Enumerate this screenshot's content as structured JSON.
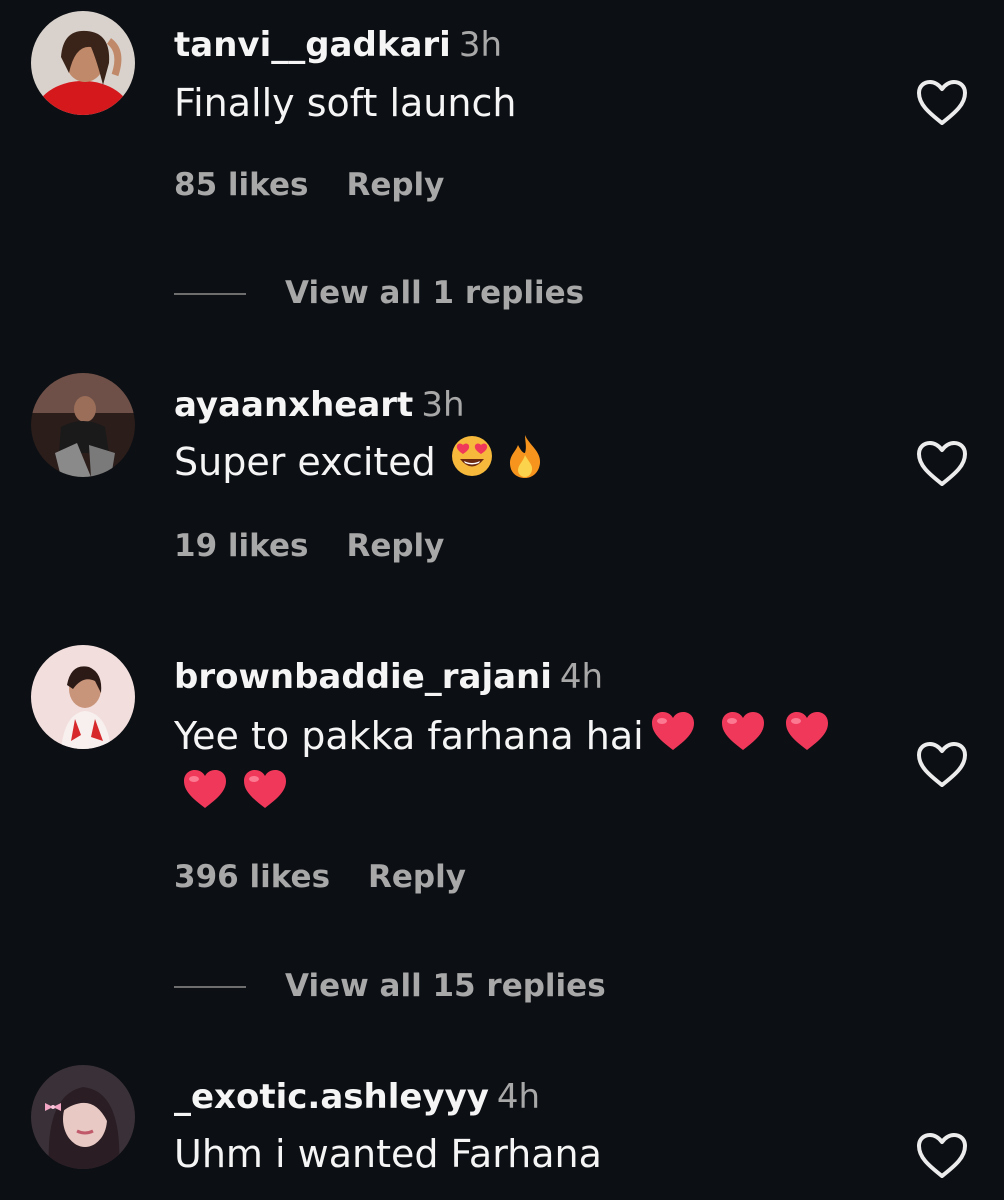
{
  "comments": [
    {
      "username": "tanvi__gadkari",
      "time": "3h",
      "text": "Finally soft launch",
      "likes": "85 likes",
      "reply_label": "Reply",
      "view_replies": "View all 1 replies"
    },
    {
      "username": "ayaanxheart",
      "time": "3h",
      "text": "Super excited",
      "emojis": [
        "smiling-face-with-heart-eyes",
        "fire"
      ],
      "likes": "19 likes",
      "reply_label": "Reply"
    },
    {
      "username": "brownbaddie_rajani",
      "time": "4h",
      "text": "Yee to pakka farhana hai",
      "emojis": [
        "red-heart",
        "red-heart",
        "red-heart",
        "red-heart",
        "red-heart"
      ],
      "likes": "396 likes",
      "reply_label": "Reply",
      "view_replies": "View all 15 replies"
    },
    {
      "username": "_exotic.ashleyyy",
      "time": "4h",
      "text": "Uhm i wanted Farhana"
    }
  ],
  "icons": {
    "like": "heart-outline-icon"
  },
  "colors": {
    "background": "#0c0f14",
    "primary_text": "#f5f5f5",
    "secondary_text": "#a8a8a8",
    "heart_emoji": "#f0385a"
  }
}
